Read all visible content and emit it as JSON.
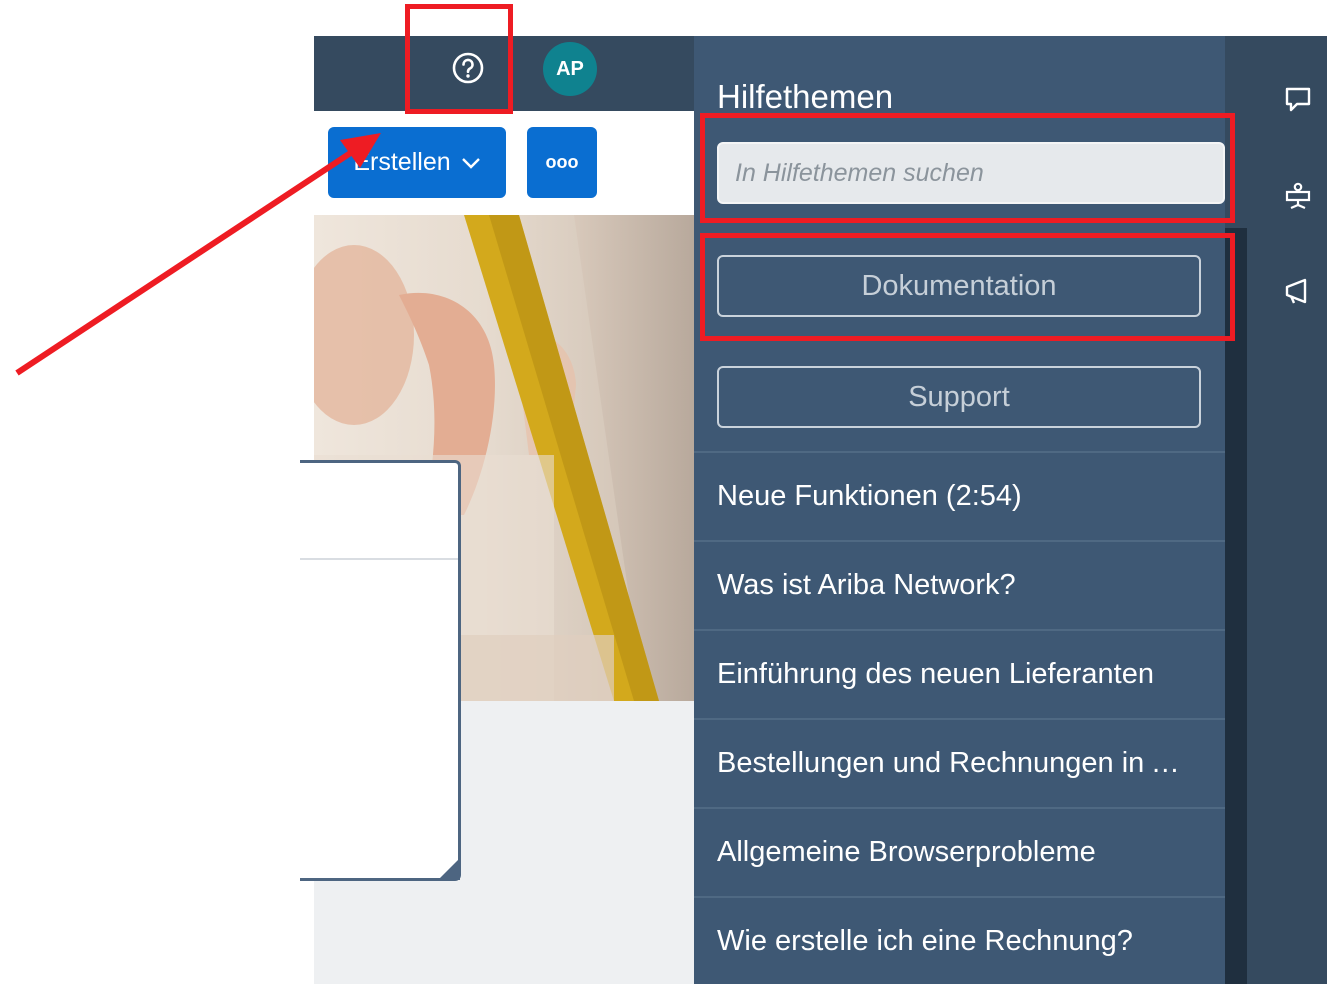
{
  "shellbar": {
    "help_icon": "help-circle-icon",
    "avatar_initials": "AP"
  },
  "toolbar": {
    "create_label": "Erstellen",
    "create_chevron": "chevron-down-icon",
    "more_label": "ooo"
  },
  "help_panel": {
    "title": "Hilfethemen",
    "search_placeholder": "In Hilfethemen suchen",
    "documentation_label": "Dokumentation",
    "support_label": "Support",
    "items": [
      {
        "label": "Neue Funktionen (2:54)"
      },
      {
        "label": "Was ist Ariba Network?"
      },
      {
        "label": "Einführung des neuen Lieferanten"
      },
      {
        "label": "Bestellungen und Rechnungen in Ariba Network"
      },
      {
        "label": "Allgemeine Browserprobleme"
      },
      {
        "label": "Wie erstelle ich eine Rechnung?"
      }
    ]
  },
  "rail": {
    "icons": [
      "chat-icon",
      "presentation-icon",
      "megaphone-icon"
    ]
  },
  "colors": {
    "shell": "#354a5f",
    "panel": "#3e5874",
    "accent": "#0a6ed1",
    "annotation": "#ee1c23",
    "avatar": "#0f828f"
  }
}
